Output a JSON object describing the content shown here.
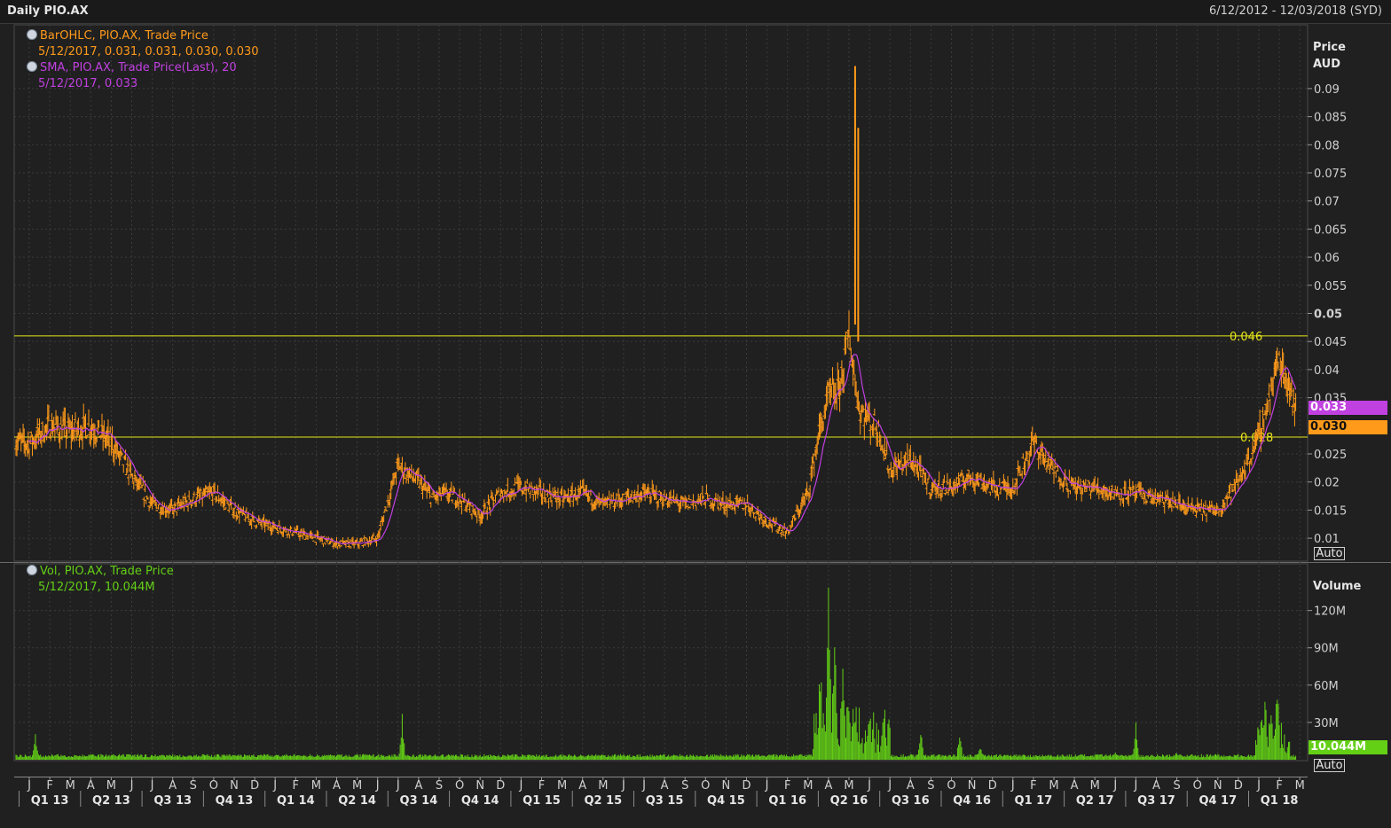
{
  "header": {
    "title": "Daily PIO.AX",
    "date_range": "6/12/2012 - 12/03/2018 (SYD)"
  },
  "colors": {
    "bg": "#202020",
    "grid": "#3b3b3b",
    "price": "#ff9a1a",
    "sma": "#c040e0",
    "volume": "#63d016",
    "hline": "#e6e61a",
    "text": "#d0d0d0"
  },
  "legend": {
    "ohlc_title": "BarOHLC, PIO.AX, Trade Price",
    "ohlc_values": "5/12/2017, 0.031, 0.031, 0.030, 0.030",
    "sma_title": "SMA, PIO.AX, Trade Price(Last),  20",
    "sma_values": "5/12/2017, 0.033",
    "vol_title": "Vol, PIO.AX, Trade Price",
    "vol_values": "5/12/2017, 10.044M"
  },
  "axis": {
    "price_title_1": "Price",
    "price_title_2": "AUD",
    "volume_title": "Volume",
    "auto_label": "Auto"
  },
  "tags": {
    "sma_last": "0.033",
    "price_last": "0.030",
    "volume_last": "10.044M"
  },
  "chart_data": [
    {
      "type": "bar",
      "subtype": "ohlc",
      "title": "",
      "ylim": [
        0.007,
        0.098
      ],
      "yticks": [
        "0.09",
        "0.085",
        "0.08",
        "0.075",
        "0.07",
        "0.065",
        "0.06",
        "0.055",
        "0.05",
        "0.045",
        "0.04",
        "0.035",
        "0.025",
        "0.02",
        "0.015",
        "0.01"
      ],
      "month_labels": [
        "J",
        "F",
        "M",
        "A",
        "M",
        "J",
        "J",
        "A",
        "S",
        "O",
        "N",
        "D",
        "J",
        "F",
        "M",
        "A",
        "M",
        "J",
        "J",
        "A",
        "S",
        "O",
        "N",
        "D",
        "J",
        "F",
        "M",
        "A",
        "M",
        "J",
        "J",
        "A",
        "S",
        "O",
        "N",
        "D",
        "J",
        "F",
        "M",
        "A",
        "M",
        "J",
        "J",
        "A",
        "S",
        "O",
        "N",
        "D",
        "J",
        "F",
        "M",
        "A",
        "M",
        "J",
        "J",
        "A",
        "S",
        "O",
        "N",
        "D",
        "J",
        "F",
        "M"
      ],
      "quarter_labels": [
        "Q1 13",
        "Q2 13",
        "Q3 13",
        "Q4 13",
        "Q1 14",
        "Q2 14",
        "Q3 14",
        "Q4 14",
        "Q1 15",
        "Q2 15",
        "Q3 15",
        "Q4 15",
        "Q1 16",
        "Q2 16",
        "Q3 16",
        "Q4 16",
        "Q1 17",
        "Q2 17",
        "Q3 17",
        "Q4 17",
        "Q1 18"
      ],
      "horizontal_lines": [
        {
          "value": 0.046,
          "label": "0.046"
        },
        {
          "value": 0.028,
          "label": "0.028"
        }
      ],
      "series": [
        {
          "name": "BarOHLC, PIO.AX, Trade Price",
          "x_months": [
            0,
            1,
            2,
            3,
            4,
            5,
            6,
            7,
            8,
            9,
            10,
            11,
            12,
            13,
            14,
            15,
            16,
            17,
            18,
            19,
            19.7,
            20.2,
            21,
            22,
            23,
            24,
            25,
            26,
            27,
            28,
            29,
            30,
            31,
            32,
            33,
            34,
            35,
            36,
            37,
            38,
            38.5,
            39,
            39.5,
            40,
            40.5,
            41,
            41.5,
            42,
            43,
            44,
            45,
            46,
            47,
            48,
            49,
            50,
            51,
            52,
            53,
            54,
            55,
            56,
            57,
            58,
            59,
            60,
            61,
            62,
            63
          ],
          "close": [
            0.027,
            0.03,
            0.029,
            0.03,
            0.027,
            0.021,
            0.016,
            0.015,
            0.017,
            0.018,
            0.015,
            0.013,
            0.012,
            0.011,
            0.01,
            0.009,
            0.009,
            0.01,
            0.023,
            0.02,
            0.017,
            0.018,
            0.017,
            0.014,
            0.018,
            0.019,
            0.018,
            0.017,
            0.018,
            0.016,
            0.017,
            0.018,
            0.017,
            0.016,
            0.017,
            0.016,
            0.016,
            0.013,
            0.011,
            0.018,
            0.028,
            0.035,
            0.036,
            0.046,
            0.033,
            0.031,
            0.029,
            0.022,
            0.024,
            0.019,
            0.019,
            0.021,
            0.019,
            0.019,
            0.027,
            0.022,
            0.019,
            0.019,
            0.018,
            0.018,
            0.017,
            0.016,
            0.015,
            0.015,
            0.02,
            0.028,
            0.042,
            0.032,
            0.03
          ],
          "spike_high": 0.094
        },
        {
          "name": "SMA, PIO.AX, Trade Price(Last),  20",
          "last": 0.033
        }
      ]
    },
    {
      "type": "bar",
      "title": "",
      "ylim": [
        0,
        150
      ],
      "yticks": [
        "120M",
        "90M",
        "60M",
        "30M"
      ],
      "series": [
        {
          "name": "Vol, PIO.AX, Trade Price",
          "x_months": [
            0.3,
            18.2,
            38.6,
            39.0,
            39.3,
            39.7,
            40.2,
            41.2,
            43.5,
            45.4,
            46.4,
            53.0,
            54.0,
            56.0,
            58.0,
            60.0,
            60.3,
            60.6,
            60.9,
            61.2
          ],
          "values": [
            25,
            38,
            88,
            148,
            120,
            85,
            40,
            15,
            30,
            25,
            12,
            8,
            30,
            8,
            5,
            30,
            62,
            50,
            76,
            10
          ]
        }
      ]
    }
  ]
}
